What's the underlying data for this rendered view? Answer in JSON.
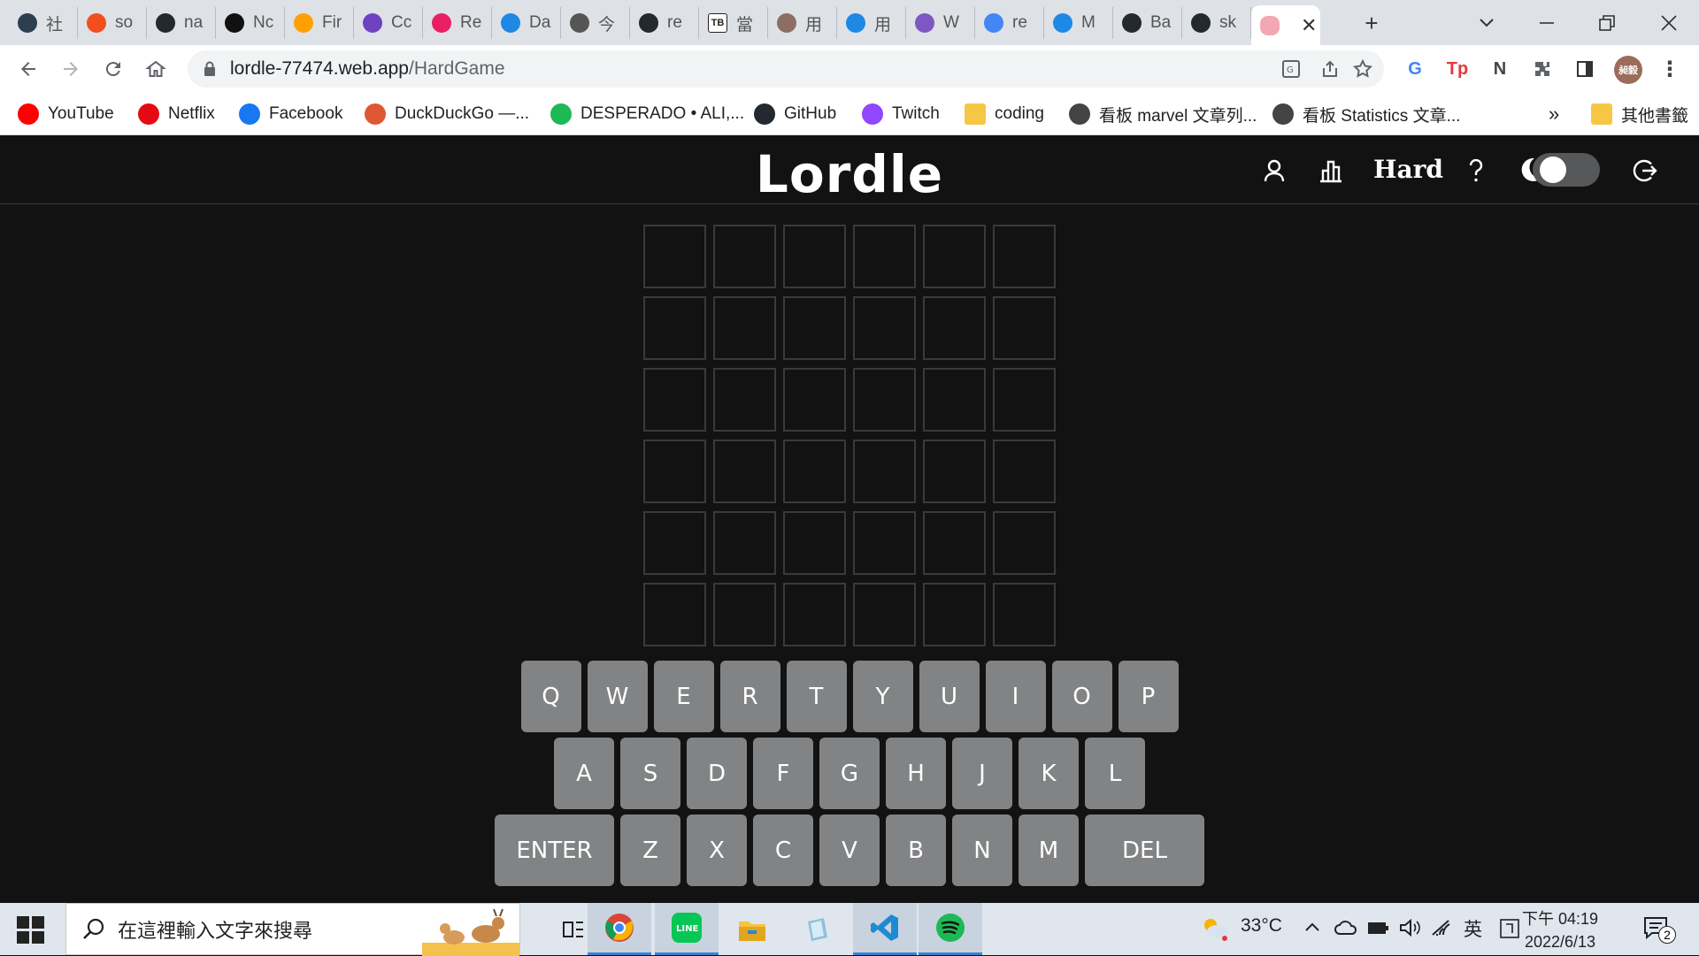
{
  "browser": {
    "tabs": [
      {
        "label": "社",
        "color": "#2c3e50"
      },
      {
        "label": "so",
        "color": "#f24e1e"
      },
      {
        "label": "na",
        "color": "#24292f"
      },
      {
        "label": "Nc",
        "color": "#111111"
      },
      {
        "label": "Fir",
        "color": "#ffa000"
      },
      {
        "label": "Cc",
        "color": "#6f42c1"
      },
      {
        "label": "Re",
        "color": "#e91e63"
      },
      {
        "label": "Da",
        "color": "#1e88e5"
      },
      {
        "label": "今",
        "color": "#555555"
      },
      {
        "label": "re",
        "color": "#24292f"
      },
      {
        "label": "當",
        "color": "#444444"
      },
      {
        "label": "用",
        "color": "#8d6e63"
      },
      {
        "label": "用",
        "color": "#1e88e5"
      },
      {
        "label": "W",
        "color": "#7e57c2"
      },
      {
        "label": "re",
        "color": "#4285f4"
      },
      {
        "label": "M",
        "color": "#1e88e5"
      },
      {
        "label": "Ba",
        "color": "#24292f"
      },
      {
        "label": "sk",
        "color": "#24292f"
      }
    ],
    "tb_label": "TB",
    "active_tab_close": "✕",
    "new_tab": "+",
    "url_host": "lordle-77474.web.app",
    "url_path": "/HardGame",
    "profile_initials": "昶毅"
  },
  "bookmarks": [
    {
      "label": "YouTube",
      "color": "#ff0000"
    },
    {
      "label": "Netflix",
      "color": "#e50914"
    },
    {
      "label": "Facebook",
      "color": "#1877f2"
    },
    {
      "label": "DuckDuckGo —...",
      "color": "#de5833"
    },
    {
      "label": "DESPERADO • ALI,...",
      "color": "#1db954"
    },
    {
      "label": "GitHub",
      "color": "#24292f"
    },
    {
      "label": "Twitch",
      "color": "#9146ff"
    },
    {
      "label": "coding",
      "color": "#f6c744"
    },
    {
      "label": "看板 marvel 文章列...",
      "color": "#444444"
    },
    {
      "label": "看板 Statistics 文章...",
      "color": "#444444"
    }
  ],
  "bookmarks_more": "»",
  "bookmarks_other": "其他書籤",
  "app": {
    "title": "Lordle",
    "mode": "Hard",
    "dark_mode": true,
    "rows": 6,
    "cols": 6,
    "keyboard": [
      [
        "Q",
        "W",
        "E",
        "R",
        "T",
        "Y",
        "U",
        "I",
        "O",
        "P"
      ],
      [
        "A",
        "S",
        "D",
        "F",
        "G",
        "H",
        "J",
        "K",
        "L"
      ],
      [
        "ENTER",
        "Z",
        "X",
        "C",
        "V",
        "B",
        "N",
        "M",
        "DEL"
      ]
    ]
  },
  "taskbar": {
    "search_placeholder": "在這裡輸入文字來搜尋",
    "weather": "33°C",
    "ime": "英",
    "time": "下午 04:19",
    "date": "2022/6/13",
    "notifications": "2"
  }
}
